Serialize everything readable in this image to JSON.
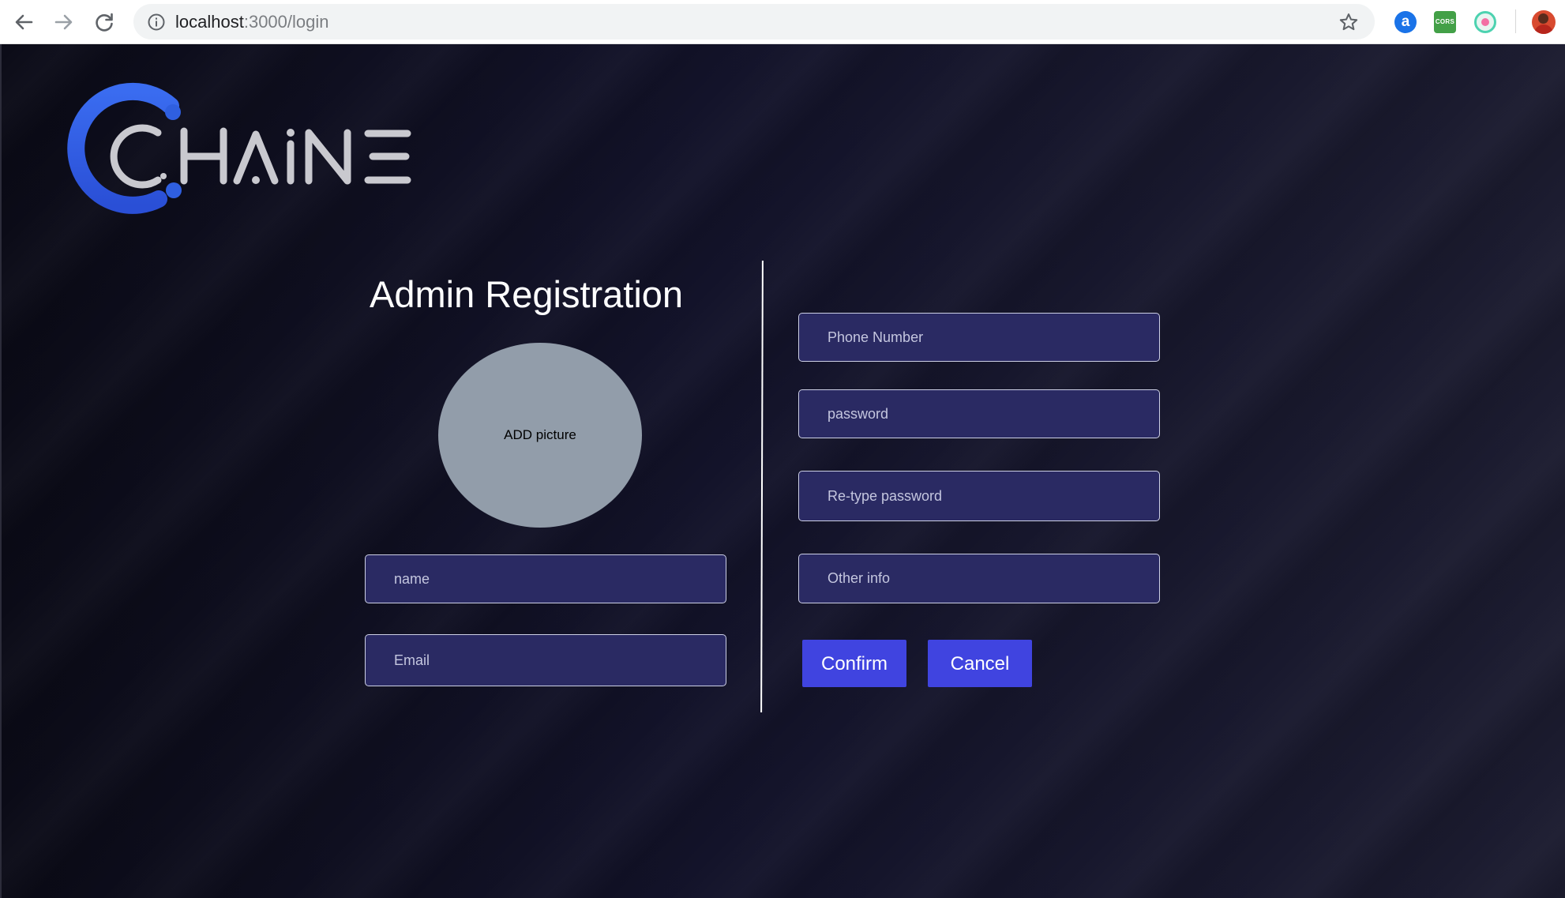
{
  "browser": {
    "url_host": "localhost",
    "url_path": ":3000/login",
    "extensions": [
      {
        "name": "a-icon",
        "label": "a"
      },
      {
        "name": "cors-icon",
        "label": "CORS"
      },
      {
        "name": "ring-extension-icon",
        "label": ""
      }
    ]
  },
  "logo": {
    "text": "CHAINE",
    "colors": {
      "ring": "#2f5fe0",
      "letters": "#c9c9cf"
    }
  },
  "form": {
    "title": "Admin Registration",
    "picture_label": "ADD picture",
    "fields": {
      "name": "name",
      "email": "Email",
      "phone": "Phone Number",
      "password": "password",
      "retype_password": "Re-type password",
      "other_info": "Other info"
    },
    "buttons": {
      "confirm": "Confirm",
      "cancel": "Cancel"
    }
  },
  "colors": {
    "button": "#4044e0",
    "field_bg": "#2a2a63",
    "picture_bg": "#929daa",
    "page_bg": "#13132a"
  }
}
